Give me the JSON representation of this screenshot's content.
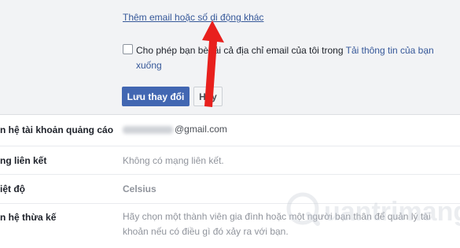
{
  "email_section": {
    "add_link": "Thêm email hoặc số di động khác",
    "permit_prefix": "Cho phép bạn bè tải cả địa chỉ email của tôi trong ",
    "permit_link": "Tải thông tin của bạn",
    "permit_suffix": "xuống",
    "save_label": "Lưu thay đổi",
    "cancel_label": "Hủy"
  },
  "rows": [
    {
      "label": "n hệ tài khoản quảng cáo",
      "value": "@gmail.com"
    },
    {
      "label": "ng liên kết",
      "value": "Không có mạng liên kết."
    },
    {
      "label": "iệt độ",
      "value": "Celsius"
    },
    {
      "label": "n hệ thừa kế",
      "value": "Hãy chọn một thành viên gia đình hoặc một người bạn thân để quản lý tài khoản nếu có điều gì đó xảy ra với bạn."
    }
  ],
  "watermark": {
    "text": "uantrimang"
  },
  "colors": {
    "link": "#365899",
    "primary_button": "#4267b2",
    "arrow": "#e8201d"
  }
}
